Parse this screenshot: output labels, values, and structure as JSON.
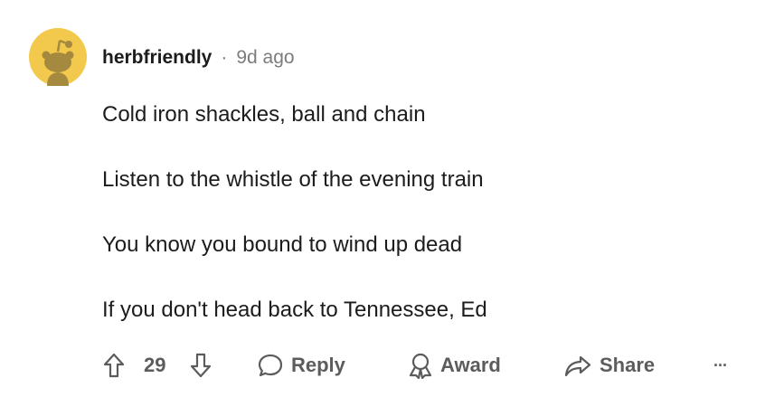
{
  "comment": {
    "username": "herbfriendly",
    "separator": "·",
    "timestamp": "9d ago",
    "lines": [
      "Cold iron shackles, ball and chain",
      "Listen to the whistle of the evening train",
      "You know you bound to wind up dead",
      "If you don't head back to Tennessee, Ed"
    ]
  },
  "actions": {
    "vote_count": "29",
    "reply_label": "Reply",
    "award_label": "Award",
    "share_label": "Share",
    "more_label": "···"
  },
  "icons": {
    "avatar": "snoo-avatar-icon",
    "upvote": "upvote-arrow-icon",
    "downvote": "downvote-arrow-icon",
    "reply": "speech-bubble-icon",
    "award": "award-ribbon-icon",
    "share": "share-arrow-icon",
    "more": "more-options-icon"
  },
  "colors": {
    "avatar_bg": "#f2c94c",
    "avatar_figure": "#a4893f",
    "text": "#1c1c1c",
    "muted": "#7c7c7c",
    "action": "#5c5c5c"
  }
}
